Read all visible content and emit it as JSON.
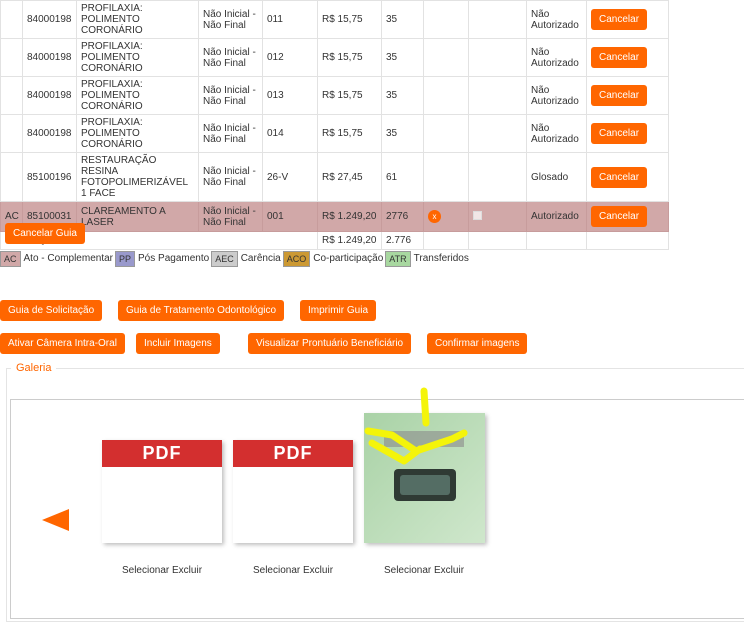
{
  "table": {
    "rows": [
      {
        "type": "",
        "code": "84000198",
        "desc": "PROFILAXIA: POLIMENTO CORONÁRIO",
        "phase": "Não Inicial - Não Final",
        "tooth": "011",
        "value": "R$ 15,75",
        "us": "35",
        "status": "Não Autorizado",
        "action": "Cancelar"
      },
      {
        "type": "",
        "code": "84000198",
        "desc": "PROFILAXIA: POLIMENTO CORONÁRIO",
        "phase": "Não Inicial - Não Final",
        "tooth": "012",
        "value": "R$ 15,75",
        "us": "35",
        "status": "Não Autorizado",
        "action": "Cancelar"
      },
      {
        "type": "",
        "code": "84000198",
        "desc": "PROFILAXIA: POLIMENTO CORONÁRIO",
        "phase": "Não Inicial - Não Final",
        "tooth": "013",
        "value": "R$ 15,75",
        "us": "35",
        "status": "Não Autorizado",
        "action": "Cancelar"
      },
      {
        "type": "",
        "code": "84000198",
        "desc": "PROFILAXIA: POLIMENTO CORONÁRIO",
        "phase": "Não Inicial - Não Final",
        "tooth": "014",
        "value": "R$ 15,75",
        "us": "35",
        "status": "Não Autorizado",
        "action": "Cancelar"
      },
      {
        "type": "",
        "code": "85100196",
        "desc": "RESTAURAÇÃO RESINA FOTOPOLIMERIZÁVEL 1 FACE",
        "phase": "Não Inicial - Não Final",
        "tooth": "26-V",
        "value": "R$ 27,45",
        "us": "61",
        "status": "Glosado",
        "action": "Cancelar"
      },
      {
        "type": "AC",
        "code": "85100031",
        "desc": "CLAREAMENTO A LASER",
        "phase": "Não Inicial - Não Final",
        "tooth": "001",
        "value": "R$ 1.249,20",
        "us": "2776",
        "status": "Autorizado",
        "action": "Cancelar",
        "mark": "x"
      }
    ],
    "total_label": "Total Orçado",
    "total_value": "R$ 1.249,20",
    "total_us": "2.776"
  },
  "cancel_guia_label": "Cancelar Guia",
  "legend": [
    {
      "code": "AC",
      "label": "Ato - Complementar",
      "color": "#d1a8a8"
    },
    {
      "code": "PP",
      "label": "Pós Pagamento",
      "color": "#9999cc"
    },
    {
      "code": "AEC",
      "label": "Carência",
      "color": "#cccccc"
    },
    {
      "code": "ACO",
      "label": "Co-participação",
      "color": "#cc9933"
    },
    {
      "code": "ATR",
      "label": "Transferidos",
      "color": "#a8d8a0"
    }
  ],
  "actions_row1": [
    "Guia de Solicitação",
    "Guia de Tratamento Odontológico",
    "Imprimir Guia"
  ],
  "actions_row2": [
    "Ativar Câmera Intra-Oral",
    "Incluir Imagens",
    "Visualizar Prontuário Beneficiário",
    "Confirmar imagens"
  ],
  "galeria": {
    "title": "Galeria",
    "items": [
      {
        "kind": "pdf",
        "label": "PDF",
        "select": "Selecionar",
        "delete": "Excluir"
      },
      {
        "kind": "pdf",
        "label": "PDF",
        "select": "Selecionar",
        "delete": "Excluir"
      },
      {
        "kind": "photo",
        "select": "Selecionar",
        "delete": "Excluir"
      }
    ]
  },
  "colors": {
    "accent": "#ff6600",
    "highlight_row": "#d1a8a8",
    "pdf_red": "#d32f2f"
  }
}
